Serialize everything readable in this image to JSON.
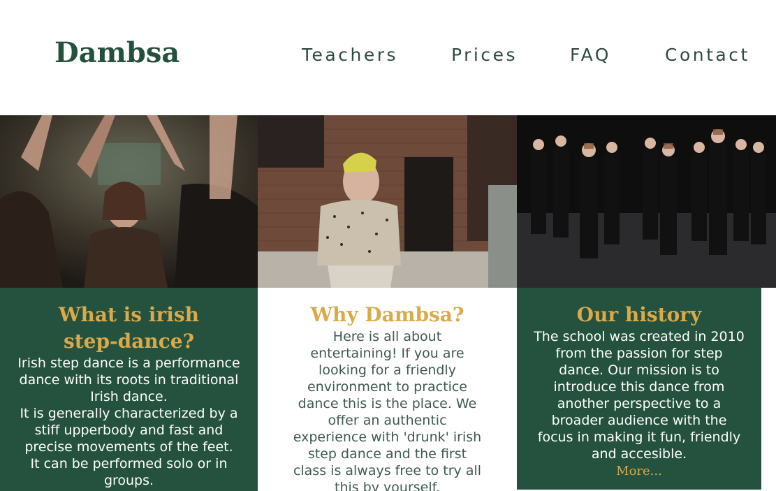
{
  "brand": {
    "logo": "Dambsa"
  },
  "nav": {
    "items": [
      {
        "label": "Teachers"
      },
      {
        "label": "Prices"
      },
      {
        "label": "FAQ"
      },
      {
        "label": "Contact"
      }
    ]
  },
  "colors": {
    "brand_green": "#24523e",
    "accent_gold": "#d9a94a",
    "nav_text": "#2f4a40"
  },
  "photos": [
    {
      "description_icon": "crowd-dancing-photo"
    },
    {
      "description_icon": "person-in-alley-photo"
    },
    {
      "description_icon": "dance-troupe-on-stage-photo"
    }
  ],
  "panels": [
    {
      "title": "What is irish step-dance?",
      "paragraphs": [
        "Irish step dance is a performance dance with its roots in traditional Irish dance.",
        "It is generally characterized by a stiff upperbody and fast and precise movements of the feet.",
        "It can be performed solo or in groups."
      ]
    },
    {
      "title": "Why Dambsa?",
      "paragraphs": [
        "Here is all about entertaining! If you are looking for a friendly environment to practice dance this is the place. We offer an authentic experience with 'drunk' irish step dance and the first class is always free to try all this by yourself."
      ]
    },
    {
      "title": "Our history",
      "paragraphs": [
        "The school was created in 2010 from the passion for step dance. Our mission is to introduce this dance from another perspective to a broader audience with the focus in making it fun, friendly and accesible."
      ],
      "more_label": "More..."
    }
  ]
}
